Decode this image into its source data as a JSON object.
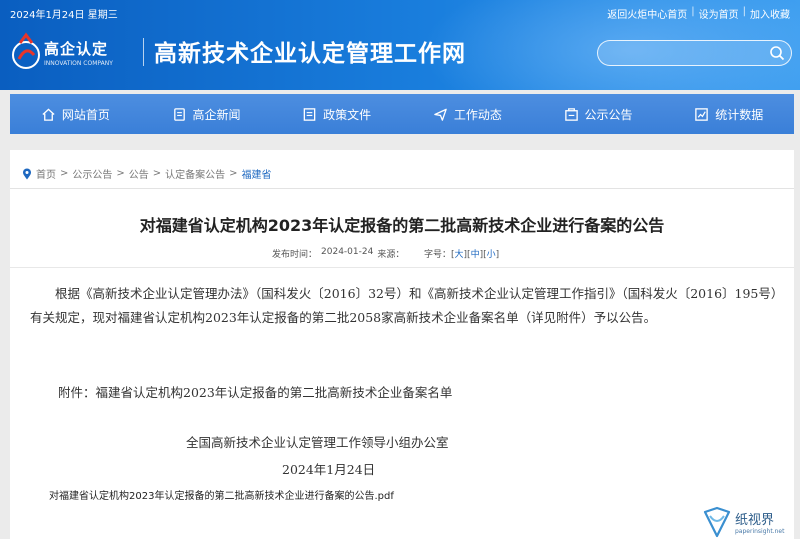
{
  "topbar": {
    "date": "2024年1月24日 星期三",
    "links": [
      "返回火炬中心首页",
      "设为首页",
      "加入收藏"
    ]
  },
  "logo": {
    "cn": "高企认定",
    "en": "INNOVATION COMPANY"
  },
  "site_title": "高新技术企业认定管理工作网",
  "search": {
    "placeholder": ""
  },
  "nav": [
    {
      "label": "网站首页",
      "icon": "home-icon"
    },
    {
      "label": "高企新闻",
      "icon": "news-icon"
    },
    {
      "label": "政策文件",
      "icon": "folder-icon"
    },
    {
      "label": "工作动态",
      "icon": "send-icon"
    },
    {
      "label": "公示公告",
      "icon": "notice-icon"
    },
    {
      "label": "统计数据",
      "icon": "chart-icon"
    }
  ],
  "breadcrumb": [
    "首页",
    "公示公告",
    "公告",
    "认定备案公告",
    "福建省"
  ],
  "article": {
    "title": "对福建省认定机构2023年认定报备的第二批高新技术企业进行备案的公告",
    "meta_label": "发布时间：",
    "meta_date": "2024-01-24",
    "meta_source": "来源：",
    "fontsize_label": "字号：",
    "fontsize_options": [
      "大",
      "中",
      "小"
    ],
    "body": "根据《高新技术企业认定管理办法》（国科发火〔2016〕32号）和《高新技术企业认定管理工作指引》（国科发火〔2016〕195号）有关规定，现对福建省认定机构2023年认定报备的第二批2058家高新技术企业备案名单（详见附件）予以公告。",
    "attachment": "附件：福建省认定机构2023年认定报备的第二批高新技术企业备案名单",
    "signature": "全国高新技术企业认定管理工作领导小组办公室",
    "sign_date": "2024年1月24日",
    "pdf_link": "对福建省认定机构2023年认定报备的第二批高新技术企业进行备案的公告.pdf"
  },
  "watermark": {
    "cn": "纸视界",
    "en": "paperinsight.net"
  }
}
